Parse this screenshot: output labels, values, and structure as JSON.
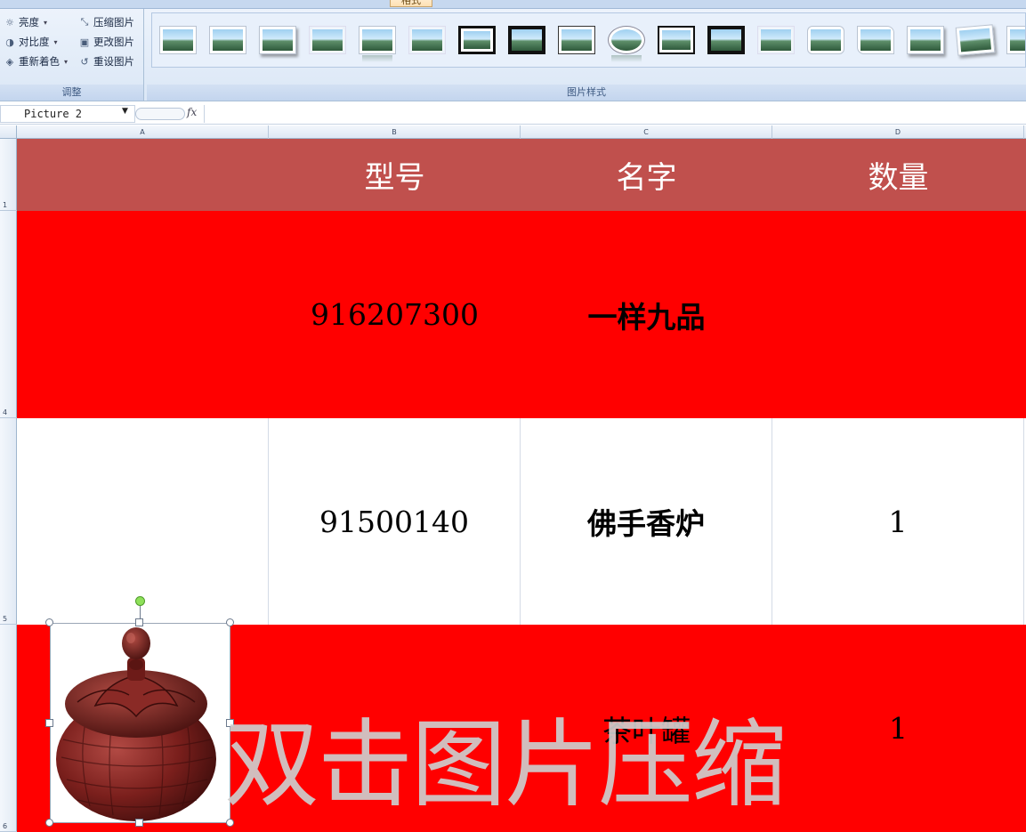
{
  "ribbon": {
    "active_tab": "格式",
    "adjust_group": {
      "label": "调整",
      "items": [
        {
          "label": "亮度",
          "icon": "sun-icon",
          "dropdown": true
        },
        {
          "label": "对比度",
          "icon": "contrast-icon",
          "dropdown": true
        },
        {
          "label": "重新着色",
          "icon": "recolor-icon",
          "dropdown": true
        },
        {
          "label": "压缩图片",
          "icon": "compress-icon",
          "dropdown": false
        },
        {
          "label": "更改图片",
          "icon": "change-picture-icon",
          "dropdown": false
        },
        {
          "label": "重设图片",
          "icon": "reset-picture-icon",
          "dropdown": false
        }
      ]
    },
    "styles_group": {
      "label": "图片样式"
    }
  },
  "formula_bar": {
    "name_box": "Picture 2",
    "fx": "fx",
    "formula": ""
  },
  "columns": [
    "A",
    "B",
    "C",
    "D"
  ],
  "rows": [
    {
      "number": "1",
      "cells": [
        "",
        "型号",
        "名字",
        "数量"
      ]
    },
    {
      "number": "4",
      "cells": [
        "",
        "916207300",
        "一样九品",
        ""
      ]
    },
    {
      "number": "5",
      "cells": [
        "",
        "91500140",
        "佛手香炉",
        "1"
      ]
    },
    {
      "number": "6",
      "cells": [
        "",
        "",
        "茶叶罐",
        "1"
      ]
    }
  ],
  "watermark": "双击图片压缩",
  "colors": {
    "header_row": "#c0504d",
    "red_row": "#ff0000",
    "watermark": "#cdcdcd"
  }
}
